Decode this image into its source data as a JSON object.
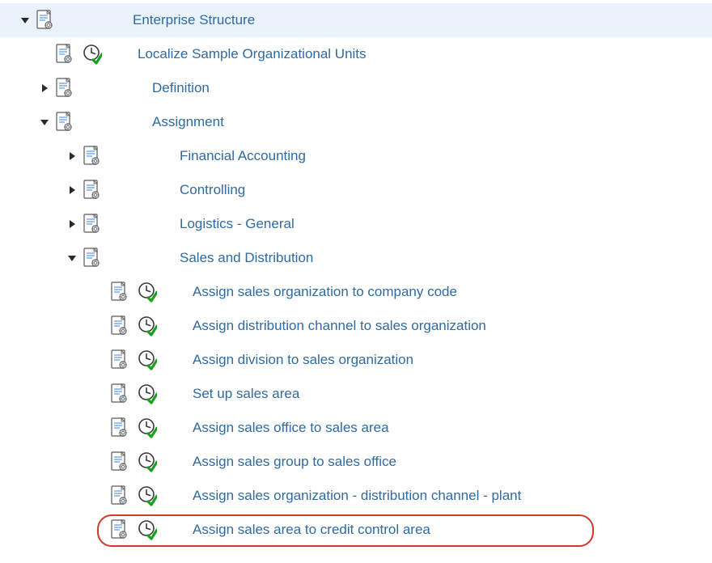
{
  "tree": {
    "root": {
      "label": "Enterprise Structure",
      "children": [
        {
          "label": "Localize Sample Organizational Units",
          "exec": true
        },
        {
          "label": "Definition",
          "expandable": true,
          "expanded": false
        },
        {
          "label": "Assignment",
          "expandable": true,
          "expanded": true,
          "children": [
            {
              "label": "Financial Accounting",
              "expandable": true,
              "expanded": false
            },
            {
              "label": "Controlling",
              "expandable": true,
              "expanded": false
            },
            {
              "label": "Logistics - General",
              "expandable": true,
              "expanded": false
            },
            {
              "label": "Sales and Distribution",
              "expandable": true,
              "expanded": true,
              "children": [
                {
                  "label": "Assign sales organization to company code",
                  "exec": true
                },
                {
                  "label": "Assign distribution channel to sales organization",
                  "exec": true
                },
                {
                  "label": "Assign division to sales organization",
                  "exec": true
                },
                {
                  "label": "Set up sales area",
                  "exec": true
                },
                {
                  "label": "Assign sales office to sales area",
                  "exec": true
                },
                {
                  "label": "Assign sales group to sales office",
                  "exec": true
                },
                {
                  "label": "Assign sales organization - distribution channel - plant",
                  "exec": true
                },
                {
                  "label": "Assign sales area to credit control area",
                  "exec": true,
                  "highlight": true
                }
              ]
            }
          ]
        }
      ]
    }
  },
  "colors": {
    "link": "#2f6aa3",
    "headerBg": "#eaf3fb",
    "highlight": "#d23b2b"
  }
}
